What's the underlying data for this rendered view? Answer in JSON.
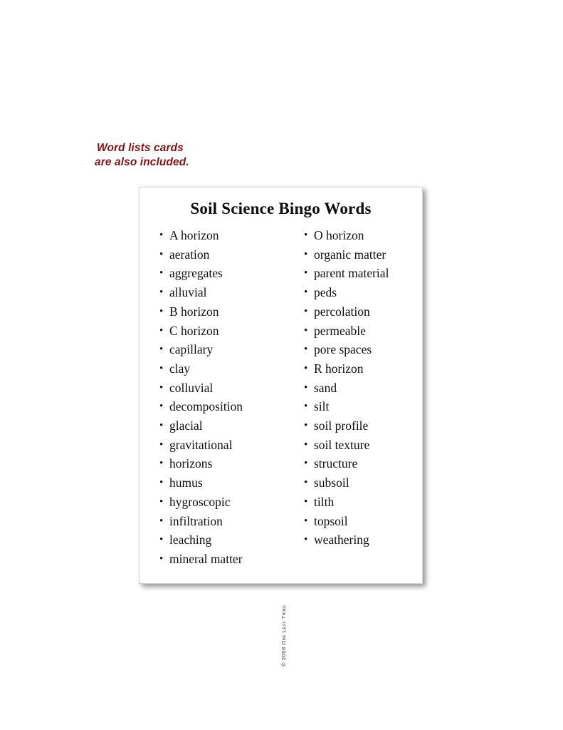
{
  "annotation": {
    "line1": "Word lists cards",
    "line2": "are also included.",
    "color": "#7d1414"
  },
  "card": {
    "title": "Soil Science Bingo Words",
    "copyright": "© 2008 One Less Thing",
    "bullet": "•",
    "border_color": "#d2d2d2",
    "background": "#ffffff",
    "columns": {
      "left": [
        "A horizon",
        "aeration",
        "aggregates",
        "alluvial",
        "B horizon",
        "C horizon",
        "capillary",
        "clay",
        "colluvial",
        "decomposition",
        "glacial",
        "gravitational",
        "horizons",
        "humus",
        "hygroscopic",
        "infiltration",
        "leaching",
        "mineral matter"
      ],
      "right": [
        "O horizon",
        "organic matter",
        "parent material",
        "peds",
        "percolation",
        "permeable",
        "pore spaces",
        "R horizon",
        "sand",
        "silt",
        "soil profile",
        "soil texture",
        "structure",
        "subsoil",
        "tilth",
        "topsoil",
        "weathering"
      ]
    }
  }
}
